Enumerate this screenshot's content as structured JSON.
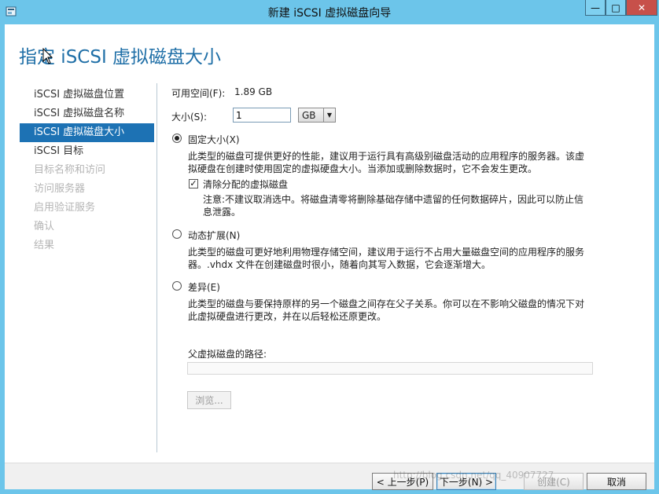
{
  "window": {
    "title": "新建 iSCSI 虚拟磁盘向导",
    "minimize_glyph": "—",
    "maximize_glyph": "□",
    "close_glyph": "✕"
  },
  "page": {
    "title": "指定 iSCSI 虚拟磁盘大小"
  },
  "nav": {
    "items": [
      {
        "label": "iSCSI 虚拟磁盘位置",
        "state": "normal"
      },
      {
        "label": "iSCSI 虚拟磁盘名称",
        "state": "normal"
      },
      {
        "label": "iSCSI 虚拟磁盘大小",
        "state": "active"
      },
      {
        "label": "iSCSI 目标",
        "state": "normal"
      },
      {
        "label": "目标名称和访问",
        "state": "disabled"
      },
      {
        "label": "访问服务器",
        "state": "disabled"
      },
      {
        "label": "启用验证服务",
        "state": "disabled"
      },
      {
        "label": "确认",
        "state": "disabled"
      },
      {
        "label": "结果",
        "state": "disabled"
      }
    ]
  },
  "form": {
    "free_space_label": "可用空间(F):",
    "free_space_value": "1.89 GB",
    "size_label": "大小(S):",
    "size_value": "1",
    "unit_selected": "GB",
    "fixed": {
      "label": "固定大小(X)",
      "checked": true,
      "desc_line1": "此类型的磁盘可提供更好的性能，建议用于运行具有高级别磁盘活动的应用程序的服务器。该虚",
      "desc_line2": "拟硬盘在创建时使用固定的虚拟硬盘大小。当添加或删除数据时，它不会发生更改。",
      "clear_label": "清除分配的虚拟磁盘",
      "clear_checked": true,
      "note_line1": "注意:不建议取消选中。将磁盘清零将删除基础存储中遗留的任何数据碎片，因此可以防止信",
      "note_line2": "息泄露。"
    },
    "dynamic": {
      "label": "动态扩展(N)",
      "checked": false,
      "desc_line1": "此类型的磁盘可更好地利用物理存储空间，建议用于运行不占用大量磁盘空间的应用程序的服务",
      "desc_line2": "器。.vhdx 文件在创建磁盘时很小，随着向其写入数据，它会逐渐增大。"
    },
    "differencing": {
      "label": "差异(E)",
      "checked": false,
      "desc_line1": "此类型的磁盘与要保持原样的另一个磁盘之间存在父子关系。你可以在不影响父磁盘的情况下对",
      "desc_line2": "此虚拟硬盘进行更改，并在以后轻松还原更改。",
      "parent_path_label": "父虚拟磁盘的路径:",
      "parent_path_value": "",
      "browse_label": "浏览..."
    }
  },
  "buttons": {
    "prev": "< 上一步(P)",
    "next": "下一步(N) >",
    "create": "创建(C)",
    "cancel": "取消"
  },
  "watermark": "http://blog.csdn.net/qq_40907727",
  "colors": {
    "titlebar": "#6cc5ea",
    "accent": "#1d72b4",
    "page_title": "#1f6fa7",
    "close_button": "#c7504a"
  }
}
